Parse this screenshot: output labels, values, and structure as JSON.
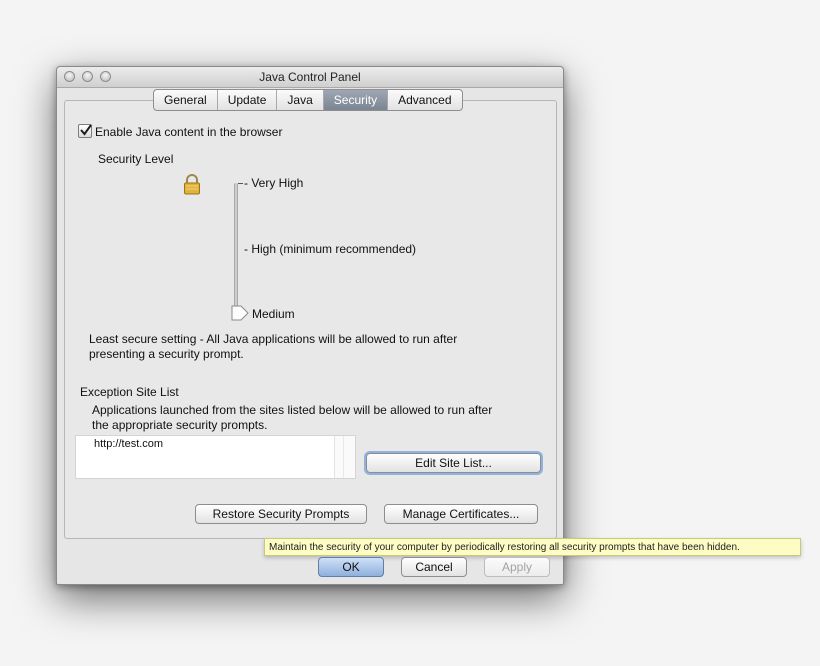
{
  "window": {
    "title": "Java Control Panel"
  },
  "tabs": [
    {
      "label": "General"
    },
    {
      "label": "Update"
    },
    {
      "label": "Java"
    },
    {
      "label": "Security",
      "active": true
    },
    {
      "label": "Advanced"
    }
  ],
  "security": {
    "enable_java_label": "Enable Java content in the browser",
    "enable_java_checked": true,
    "level_heading": "Security Level",
    "levels": [
      "- Very High",
      "- High (minimum recommended)",
      "Medium"
    ],
    "selected_level": "Medium",
    "level_description_line1": "Least secure setting - All Java applications will be allowed to run after",
    "level_description_line2": "presenting a security prompt."
  },
  "exception_site_list": {
    "heading": "Exception Site List",
    "description_line1": "Applications launched from the sites listed below will be allowed to run after",
    "description_line2": "the appropriate security prompts.",
    "sites": [
      "http://test.com"
    ],
    "edit_button": "Edit Site List..."
  },
  "actions": {
    "restore_prompts": "Restore Security Prompts",
    "manage_certificates": "Manage Certificates..."
  },
  "tooltip": "Maintain the security of your computer by periodically restoring all security prompts that have been hidden.",
  "footer": {
    "ok": "OK",
    "cancel": "Cancel",
    "apply": "Apply"
  },
  "icons": {
    "window_buttons": [
      "close-icon",
      "minimize-icon",
      "zoom-icon"
    ],
    "lock": "padlock-icon"
  }
}
